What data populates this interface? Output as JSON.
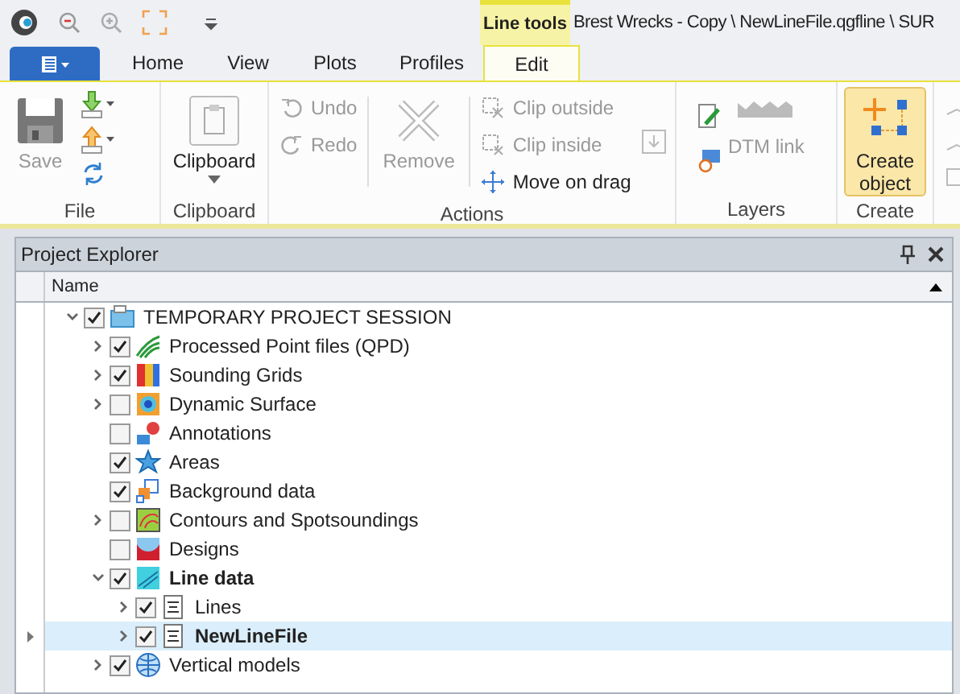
{
  "title_bar": {
    "context_label": "Line tools",
    "title": "Brest Wrecks - Copy \\ NewLineFile.qgfline \\ SUR"
  },
  "tabs": [
    {
      "label": "Home",
      "selected": false
    },
    {
      "label": "View",
      "selected": false
    },
    {
      "label": "Plots",
      "selected": false
    },
    {
      "label": "Profiles",
      "selected": false
    },
    {
      "label": "Edit",
      "selected": true
    }
  ],
  "ribbon": [
    {
      "name": "File",
      "buttons": [
        {
          "kind": "save",
          "label": "Save",
          "disabled": true
        }
      ]
    },
    {
      "name": "Clipboard",
      "buttons": [
        {
          "kind": "clipboard",
          "label": "Clipboard",
          "disabled": false
        }
      ]
    },
    {
      "name": "Actions",
      "buttons": [
        {
          "kind": "undo",
          "label": "Undo",
          "disabled": true
        },
        {
          "kind": "redo",
          "label": "Redo",
          "disabled": true
        },
        {
          "kind": "remove",
          "label": "Remove",
          "disabled": true
        },
        {
          "kind": "clip_outside",
          "label": "Clip outside",
          "disabled": true
        },
        {
          "kind": "clip_inside",
          "label": "Clip inside",
          "disabled": true
        },
        {
          "kind": "move",
          "label": "Move on drag",
          "disabled": false
        }
      ]
    },
    {
      "name": "Layers",
      "buttons": [
        {
          "kind": "dtm",
          "label": "DTM link",
          "disabled": true
        }
      ]
    },
    {
      "name": "Create",
      "buttons": [
        {
          "kind": "create",
          "label": "Create object",
          "selected": true
        }
      ]
    }
  ],
  "project_explorer": {
    "title": "Project Explorer",
    "column": "Name",
    "tree": [
      {
        "label": "TEMPORARY PROJECT SESSION",
        "kind": "folder",
        "checked": true,
        "expanded": true,
        "bold": false,
        "selected": false,
        "children": [
          {
            "label": "Processed Point files (QPD)",
            "kind": "qpd",
            "checked": true,
            "expanded": false,
            "bold": false,
            "selected": false
          },
          {
            "label": "Sounding Grids",
            "kind": "grid",
            "checked": true,
            "expanded": false,
            "bold": false,
            "selected": false
          },
          {
            "label": "Dynamic Surface",
            "kind": "surface",
            "checked": false,
            "expanded": false,
            "bold": false,
            "selected": false
          },
          {
            "label": "Annotations",
            "kind": "annotation",
            "checked": false,
            "bold": false,
            "selected": false
          },
          {
            "label": "Areas",
            "kind": "area",
            "checked": true,
            "bold": false,
            "selected": false
          },
          {
            "label": "Background data",
            "kind": "background",
            "checked": true,
            "bold": false,
            "selected": false
          },
          {
            "label": "Contours and Spotsoundings",
            "kind": "contour",
            "checked": false,
            "expanded": false,
            "bold": false,
            "selected": false
          },
          {
            "label": "Designs",
            "kind": "design",
            "checked": false,
            "bold": false,
            "selected": false
          },
          {
            "label": "Line data",
            "kind": "line",
            "checked": true,
            "expanded": true,
            "bold": true,
            "selected": false,
            "children": [
              {
                "label": "Lines",
                "kind": "file",
                "checked": true,
                "expanded": false,
                "bold": false,
                "selected": false
              },
              {
                "label": "NewLineFile",
                "kind": "file",
                "checked": true,
                "expanded": false,
                "bold": true,
                "selected": true
              }
            ]
          },
          {
            "label": "Vertical models",
            "kind": "globe",
            "checked": true,
            "expanded": false,
            "bold": false,
            "selected": false
          }
        ]
      }
    ]
  }
}
